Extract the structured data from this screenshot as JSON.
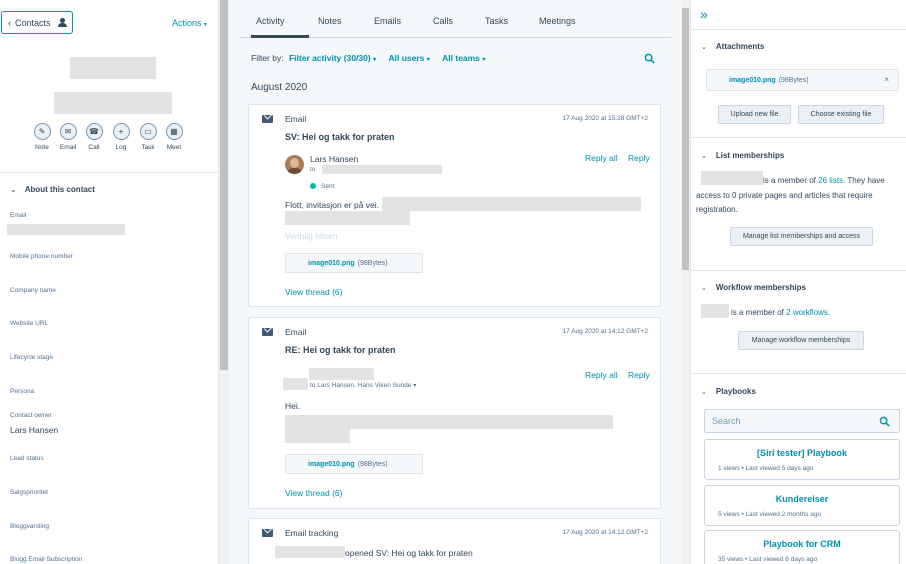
{
  "left": {
    "contacts_label": "Contacts",
    "actions_label": "Actions",
    "quick_actions": [
      {
        "label": "Note",
        "icon": "✎"
      },
      {
        "label": "Email",
        "icon": "✉"
      },
      {
        "label": "Call",
        "icon": "☎"
      },
      {
        "label": "Log",
        "icon": "+"
      },
      {
        "label": "Task",
        "icon": "▭"
      },
      {
        "label": "Meet",
        "icon": "▦"
      }
    ],
    "about_title": "About this contact",
    "properties": [
      {
        "label": "Email",
        "value": ""
      },
      {
        "label": "Mobile phone number",
        "value": ""
      },
      {
        "label": "Company name",
        "value": ""
      },
      {
        "label": "Website URL",
        "value": ""
      },
      {
        "label": "Lifecycle stage",
        "value": ""
      },
      {
        "label": "Persona",
        "value": ""
      },
      {
        "label": "Contact owner",
        "value": "Lars Hansen"
      },
      {
        "label": "Lead status",
        "value": ""
      },
      {
        "label": "Salgsprioritet",
        "value": ""
      },
      {
        "label": "Bloggvarsling",
        "value": ""
      },
      {
        "label": "Blogg Email Subscription",
        "value": ""
      }
    ]
  },
  "mid": {
    "tabs": [
      "Activity",
      "Notes",
      "Emails",
      "Calls",
      "Tasks",
      "Meetings"
    ],
    "filter_by": "Filter by:",
    "filter_activity": "Filter activity (30/30)",
    "all_users": "All users",
    "all_teams": "All teams",
    "month": "August 2020",
    "card1": {
      "type": "Email",
      "date": "17 Aug 2020 at 15:28 GMT+2",
      "subject": "SV: Hei og takk for praten",
      "reply_all": "Reply all",
      "reply": "Reply",
      "sender": "Lars Hansen",
      "to": "to",
      "sent": "Sent",
      "body": "Flott, invitasjon er på vei.",
      "faded": "Vennlig hilsen",
      "attachment_name": "image010.png",
      "attachment_size": "(98Bytes)",
      "view_thread": "View thread (6)"
    },
    "card2": {
      "type": "Email",
      "date": "17 Aug 2020 at 14:12 GMT+2",
      "subject": "RE: Hei og takk for praten",
      "reply_all": "Reply all",
      "reply": "Reply",
      "to": "to Lars Hansen, Hans Viken Sunde",
      "body": "Hei.",
      "attachment_name": "image010.png",
      "attachment_size": "(98Bytes)",
      "view_thread": "View thread (6)"
    },
    "card3": {
      "type": "Email tracking",
      "date": "17 Aug 2020 at 14:12 GMT+2",
      "text": "opened SV: Hei og takk for praten"
    }
  },
  "right": {
    "attachments_title": "Attachments",
    "attachment_name": "image010.png",
    "attachment_size": "(98Bytes)",
    "upload_new": "Upload new file",
    "choose_existing": "Choose existing file",
    "list_title": "List memberships",
    "list_text_a": "is a member of",
    "list_count": "26 lists",
    "list_text_b": ". They have access to 0 private pages and articles that require registration.",
    "manage_lists": "Manage list memberships and access",
    "workflow_title": "Workflow memberships",
    "workflow_text": "is a member of",
    "workflow_count": "2 workflows.",
    "manage_workflows": "Manage workflow memberships",
    "playbooks_title": "Playbooks",
    "search_placeholder": "Search",
    "playbooks": [
      {
        "title": "[Siri tester] Playbook",
        "meta": "1 views • Last viewed 5 days ago"
      },
      {
        "title": "Kundereiser",
        "meta": "5 views • Last viewed 2 months ago"
      },
      {
        "title": "Playbook for CRM",
        "meta": "35 views • Last viewed 6 days ago"
      }
    ]
  }
}
